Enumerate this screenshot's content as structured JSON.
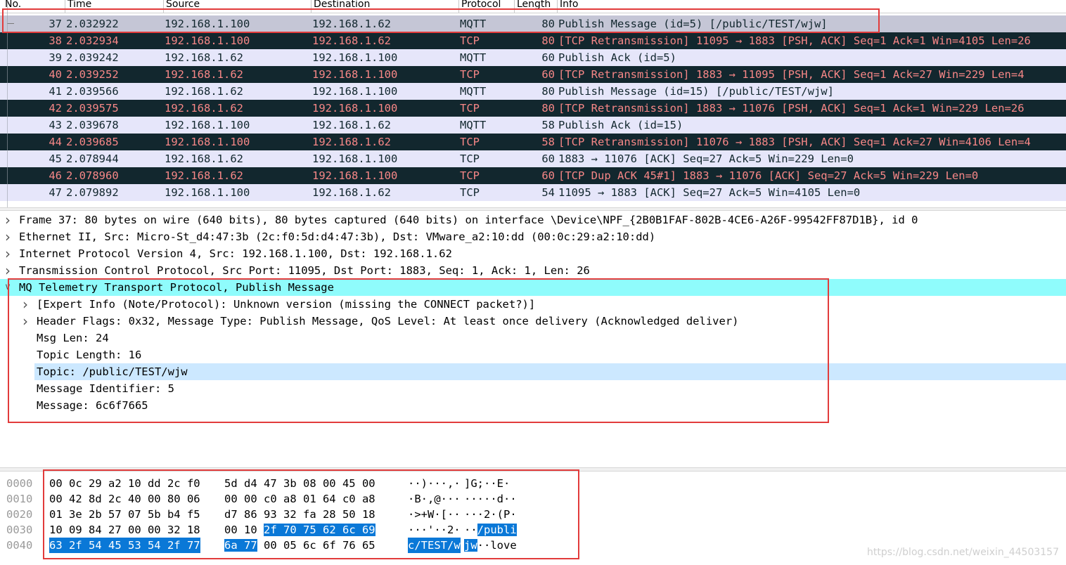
{
  "columns": [
    "No.",
    "Time",
    "Source",
    "Destination",
    "Protocol",
    "Length",
    "Info"
  ],
  "packets": [
    {
      "no": "37",
      "time": "2.032922",
      "src": "192.168.1.100",
      "dst": "192.168.1.62",
      "proto": "MQTT",
      "len": "80",
      "info": "Publish Message (id=5) [/public/TEST/wjw]",
      "style": "selected"
    },
    {
      "no": "38",
      "time": "2.032934",
      "src": "192.168.1.100",
      "dst": "192.168.1.62",
      "proto": "TCP",
      "len": "80",
      "info": "[TCP Retransmission] 11095 → 1883 [PSH, ACK] Seq=1 Ack=1 Win=4105 Len=26",
      "style": "dark"
    },
    {
      "no": "39",
      "time": "2.039242",
      "src": "192.168.1.62",
      "dst": "192.168.1.100",
      "proto": "MQTT",
      "len": "60",
      "info": "Publish Ack (id=5)",
      "style": "light"
    },
    {
      "no": "40",
      "time": "2.039252",
      "src": "192.168.1.62",
      "dst": "192.168.1.100",
      "proto": "TCP",
      "len": "60",
      "info": "[TCP Retransmission] 1883 → 11095 [PSH, ACK] Seq=1 Ack=27 Win=229 Len=4",
      "style": "dark"
    },
    {
      "no": "41",
      "time": "2.039566",
      "src": "192.168.1.62",
      "dst": "192.168.1.100",
      "proto": "MQTT",
      "len": "80",
      "info": "Publish Message (id=15) [/public/TEST/wjw]",
      "style": "light"
    },
    {
      "no": "42",
      "time": "2.039575",
      "src": "192.168.1.62",
      "dst": "192.168.1.100",
      "proto": "TCP",
      "len": "80",
      "info": "[TCP Retransmission] 1883 → 11076 [PSH, ACK] Seq=1 Ack=1 Win=229 Len=26",
      "style": "dark"
    },
    {
      "no": "43",
      "time": "2.039678",
      "src": "192.168.1.100",
      "dst": "192.168.1.62",
      "proto": "MQTT",
      "len": "58",
      "info": "Publish Ack (id=15)",
      "style": "light"
    },
    {
      "no": "44",
      "time": "2.039685",
      "src": "192.168.1.100",
      "dst": "192.168.1.62",
      "proto": "TCP",
      "len": "58",
      "info": "[TCP Retransmission] 11076 → 1883 [PSH, ACK] Seq=1 Ack=27 Win=4106 Len=4",
      "style": "dark"
    },
    {
      "no": "45",
      "time": "2.078944",
      "src": "192.168.1.62",
      "dst": "192.168.1.100",
      "proto": "TCP",
      "len": "60",
      "info": "1883 → 11076 [ACK] Seq=27 Ack=5 Win=229 Len=0",
      "style": "light"
    },
    {
      "no": "46",
      "time": "2.078960",
      "src": "192.168.1.62",
      "dst": "192.168.1.100",
      "proto": "TCP",
      "len": "60",
      "info": "[TCP Dup ACK 45#1] 1883 → 11076 [ACK] Seq=27 Ack=5 Win=229 Len=0",
      "style": "dark"
    },
    {
      "no": "47",
      "time": "2.079892",
      "src": "192.168.1.100",
      "dst": "192.168.1.62",
      "proto": "TCP",
      "len": "54",
      "info": "11095 → 1883 [ACK] Seq=27 Ack=5 Win=4105 Len=0",
      "style": "light"
    }
  ],
  "details": [
    {
      "text": "Frame 37: 80 bytes on wire (640 bits), 80 bytes captured (640 bits) on interface \\Device\\NPF_{2B0B1FAF-802B-4CE6-A26F-99542FF87D1B}, id 0",
      "indent": 0,
      "arrow": "right",
      "hl": ""
    },
    {
      "text": "Ethernet II, Src: Micro-St_d4:47:3b (2c:f0:5d:d4:47:3b), Dst: VMware_a2:10:dd (00:0c:29:a2:10:dd)",
      "indent": 0,
      "arrow": "right",
      "hl": ""
    },
    {
      "text": "Internet Protocol Version 4, Src: 192.168.1.100, Dst: 192.168.1.62",
      "indent": 0,
      "arrow": "right",
      "hl": ""
    },
    {
      "text": "Transmission Control Protocol, Src Port: 11095, Dst Port: 1883, Seq: 1, Ack: 1, Len: 26",
      "indent": 0,
      "arrow": "right",
      "hl": ""
    },
    {
      "text": "MQ Telemetry Transport Protocol, Publish Message",
      "indent": 0,
      "arrow": "down",
      "hl": "cyan"
    },
    {
      "text": "[Expert Info (Note/Protocol): Unknown version (missing the CONNECT packet?)]",
      "indent": 1,
      "arrow": "right",
      "hl": ""
    },
    {
      "text": "Header Flags: 0x32, Message Type: Publish Message, QoS Level: At least once delivery (Acknowledged deliver)",
      "indent": 1,
      "arrow": "right",
      "hl": ""
    },
    {
      "text": "Msg Len: 24",
      "indent": 1,
      "arrow": "",
      "hl": ""
    },
    {
      "text": "Topic Length: 16",
      "indent": 1,
      "arrow": "",
      "hl": ""
    },
    {
      "text": "Topic: /public/TEST/wjw",
      "indent": 1,
      "arrow": "",
      "hl": "blue"
    },
    {
      "text": "Message Identifier: 5",
      "indent": 1,
      "arrow": "",
      "hl": ""
    },
    {
      "text": "Message: 6c6f7665",
      "indent": 1,
      "arrow": "",
      "hl": ""
    }
  ],
  "bytes": [
    {
      "offset": "0000",
      "hexA": "00 0c 29 a2 10 dd 2c f0",
      "hexB": "5d d4 47 3b 08 00 45 00",
      "asciiA": "··)···,·",
      "asciiB": " ]G;··E·",
      "selA": "",
      "selB": "",
      "selAsA": "",
      "selAsB": ""
    },
    {
      "offset": "0010",
      "hexA": "00 42 8d 2c 40 00 80 06",
      "hexB": "00 00 c0 a8 01 64 c0 a8",
      "asciiA": "·B·,@···",
      "asciiB": " ·····d··",
      "selA": "",
      "selB": "",
      "selAsA": "",
      "selAsB": ""
    },
    {
      "offset": "0020",
      "hexA": "01 3e 2b 57 07 5b b4 f5",
      "hexB": "d7 86 93 32 fa 28 50 18",
      "asciiA": "·>+W·[··",
      "asciiB": " ···2·(P·",
      "selA": "",
      "selB": "",
      "selAsA": "",
      "selAsB": ""
    },
    {
      "offset": "0030",
      "hexA": "10 09 84 27 00 00 32 18",
      "hexB": "00 10 ",
      "hexBsel": "2f 70 75 62 6c 69",
      "asciiA": "···'··2·",
      "asciiB": " ··",
      "asciiBsel": "/publi"
    },
    {
      "offset": "0040",
      "hexAsel": "63 2f 54 45 53 54 2f 77",
      "hexBsel2": "6a 77",
      "hexBrest": " 00 05 6c 6f 76 65",
      "asciiAsel": "c/TEST/w",
      "asciiBsel2": " jw",
      "asciiBrest": "··love"
    }
  ],
  "watermark": "https://blog.csdn.net/weixin_44503157"
}
